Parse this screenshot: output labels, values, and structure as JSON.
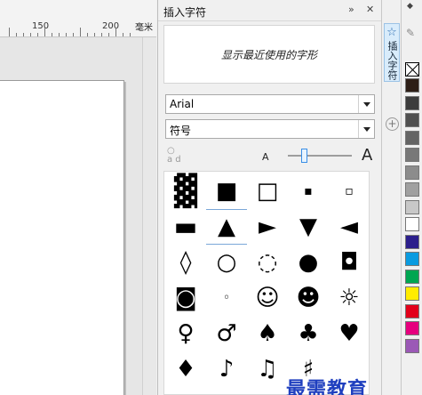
{
  "ruler": {
    "label_150": "150",
    "label_200": "200",
    "unit": "毫米"
  },
  "docker": {
    "title": "插入字符",
    "recent_placeholder": "显示最近使用的字形",
    "font_value": "Arial",
    "subset_value": "符号",
    "ab_icon": "ảd",
    "small_a": "A",
    "big_a": "A",
    "slider_percent": 25
  },
  "glyphs": [
    [
      "▓",
      "■",
      "□",
      "▪",
      "▫"
    ],
    [
      "▬",
      "▲",
      "►",
      "▼",
      "◄"
    ],
    [
      "◊",
      "○",
      "◌",
      "●",
      "◘"
    ],
    [
      "◙",
      "◦",
      "☺",
      "☻",
      "☼"
    ],
    [
      "♀",
      "♂",
      "♠",
      "♣",
      "♥"
    ],
    [
      "♦",
      "♪",
      "♫",
      "♯",
      ""
    ]
  ],
  "tabs": {
    "star": "☆",
    "label": "插入字符",
    "add": "+"
  },
  "palette": {
    "top_arrow": "◆",
    "eyedrop": "✎",
    "colors": [
      "#2d1e16",
      "#3c3c3c",
      "#505050",
      "#646464",
      "#787878",
      "#8c8c8c",
      "#a0a0a0",
      "#c8c8c8",
      "#ffffff",
      "#2c1f8c",
      "#0a9be0",
      "#00a651",
      "#ffec00",
      "#e2001a",
      "#e6007e",
      "#9b59b6"
    ]
  },
  "watermark": "最需教育"
}
